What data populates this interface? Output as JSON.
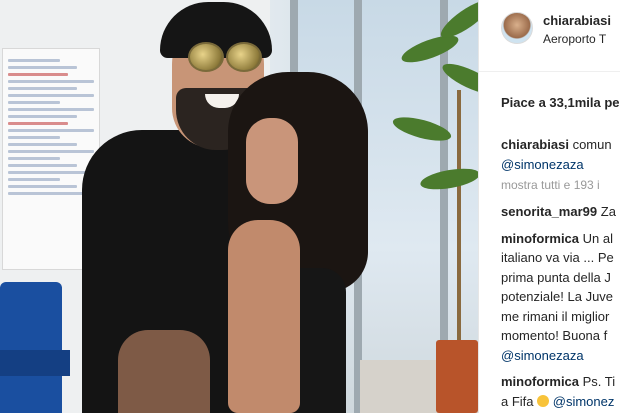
{
  "post": {
    "username": "chiarabiasi",
    "location": "Aeroporto T",
    "likes_label": "Piace a 33,1mila pe",
    "caption": {
      "author": "chiarabiasi",
      "text_line1": "comun",
      "mention": "@simonezaza"
    },
    "load_more": "mostra tutti e 193 i",
    "comments": [
      {
        "author": "senorita_mar99",
        "lines": [
          "Za"
        ]
      },
      {
        "author": "minoformica",
        "lines": [
          "Un al",
          "italiano va via ... Pe",
          "prima punta della J",
          "potenziale! La Juve",
          "me rimani il miglior",
          "momento! Buona f"
        ],
        "mention": "@simonezaza"
      },
      {
        "author": "minoformica",
        "first_line": "Ps. Ti",
        "second_line_prefix": "a Fifa",
        "mention": "@simonez"
      }
    ]
  },
  "photo": {
    "icons": [
      "person-photo"
    ],
    "accent_chair_color": "#1a4fa0",
    "pot_color": "#b8542a"
  }
}
